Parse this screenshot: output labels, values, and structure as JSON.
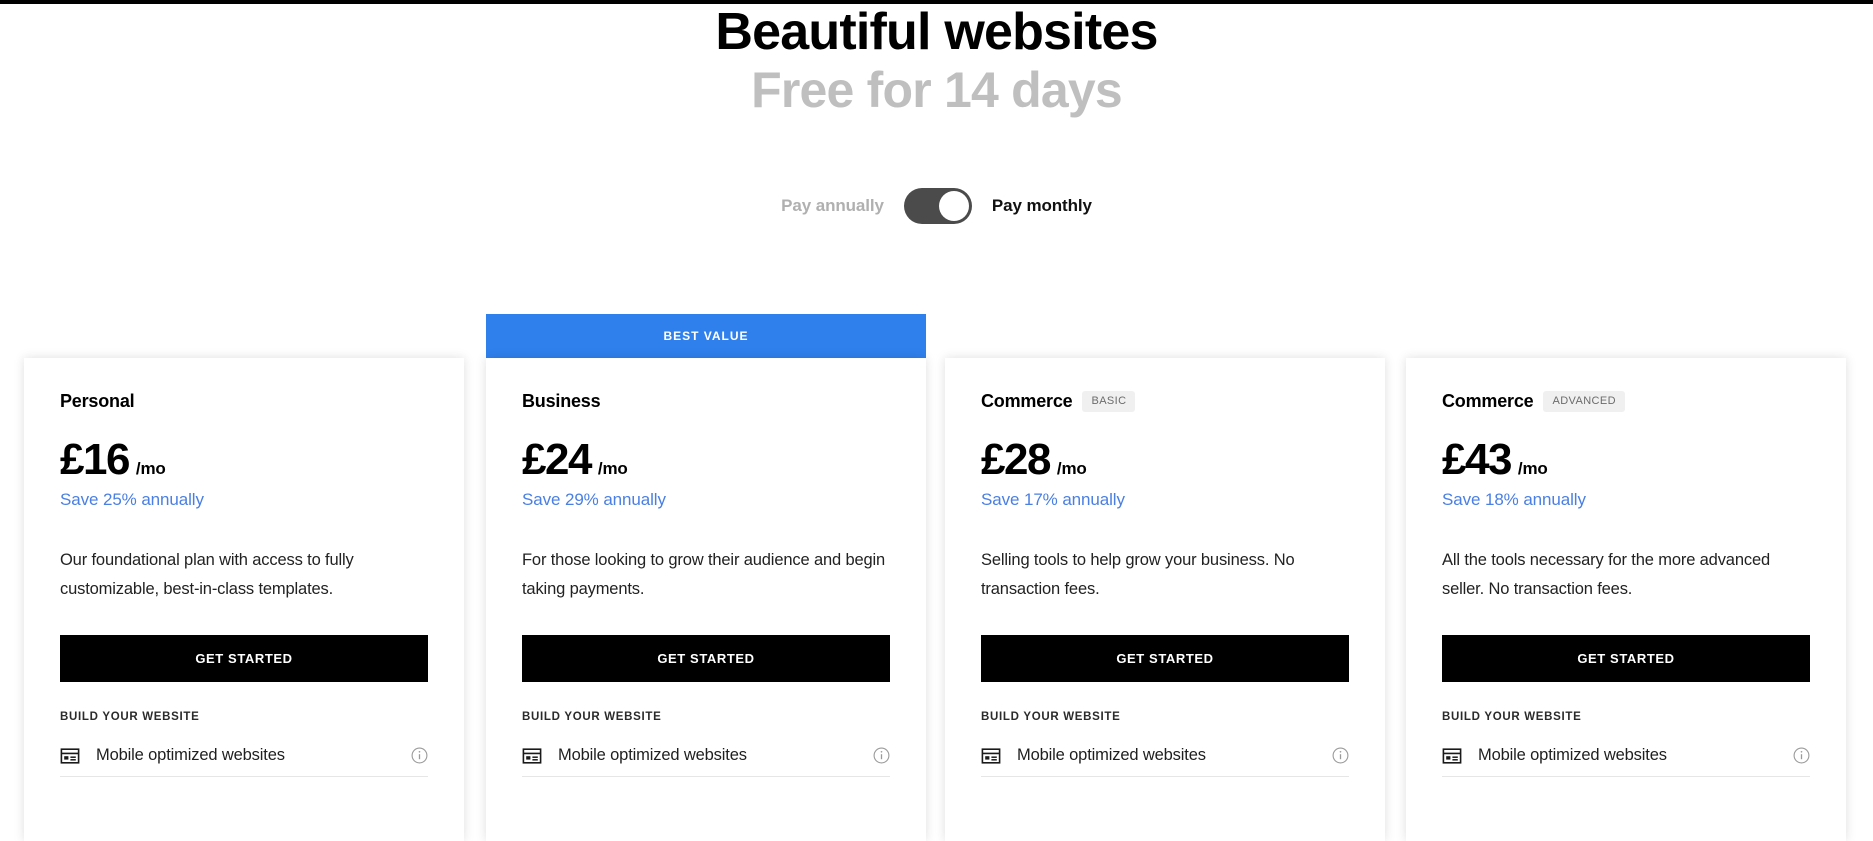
{
  "hero": {
    "title": "Beautiful websites",
    "subtitle": "Free for 14 days"
  },
  "billing": {
    "annual_label": "Pay annually",
    "monthly_label": "Pay monthly",
    "selected": "Pay monthly",
    "toggle_position": "right"
  },
  "colors": {
    "accent_blue": "#2f80ed",
    "save_link_blue": "#4a7fe3",
    "cta_black": "#000000",
    "badge_gray": "#f0f0f0",
    "toggle_track": "#4b4b4b"
  },
  "banner": {
    "best_value_label": "BEST VALUE"
  },
  "feature_group_label": "BUILD YOUR WEBSITE",
  "plans": [
    {
      "name": "Personal",
      "badge": "",
      "price": "£16",
      "period": "/mo",
      "save_note": "Save 25% annually",
      "description": "Our foundational plan with access to fully customizable, best-in-class templates.",
      "cta_label": "GET STARTED",
      "highlighted": false,
      "features": [
        {
          "icon": "browser-window-icon",
          "label": "Mobile optimized websites",
          "info": "info-icon"
        }
      ]
    },
    {
      "name": "Business",
      "badge": "",
      "price": "£24",
      "period": "/mo",
      "save_note": "Save 29% annually",
      "description": "For those looking to grow their audience and begin taking payments.",
      "cta_label": "GET STARTED",
      "highlighted": true,
      "features": [
        {
          "icon": "browser-window-icon",
          "label": "Mobile optimized websites",
          "info": "info-icon"
        }
      ]
    },
    {
      "name": "Commerce",
      "badge": "BASIC",
      "price": "£28",
      "period": "/mo",
      "save_note": "Save 17% annually",
      "description": "Selling tools to help grow your business. No transaction fees.",
      "cta_label": "GET STARTED",
      "highlighted": false,
      "features": [
        {
          "icon": "browser-window-icon",
          "label": "Mobile optimized websites",
          "info": "info-icon"
        }
      ]
    },
    {
      "name": "Commerce",
      "badge": "ADVANCED",
      "price": "£43",
      "period": "/mo",
      "save_note": "Save 18% annually",
      "description": "All the tools necessary for the more advanced seller. No transaction fees.",
      "cta_label": "GET STARTED",
      "highlighted": false,
      "features": [
        {
          "icon": "browser-window-icon",
          "label": "Mobile optimized websites",
          "info": "info-icon"
        }
      ]
    }
  ]
}
